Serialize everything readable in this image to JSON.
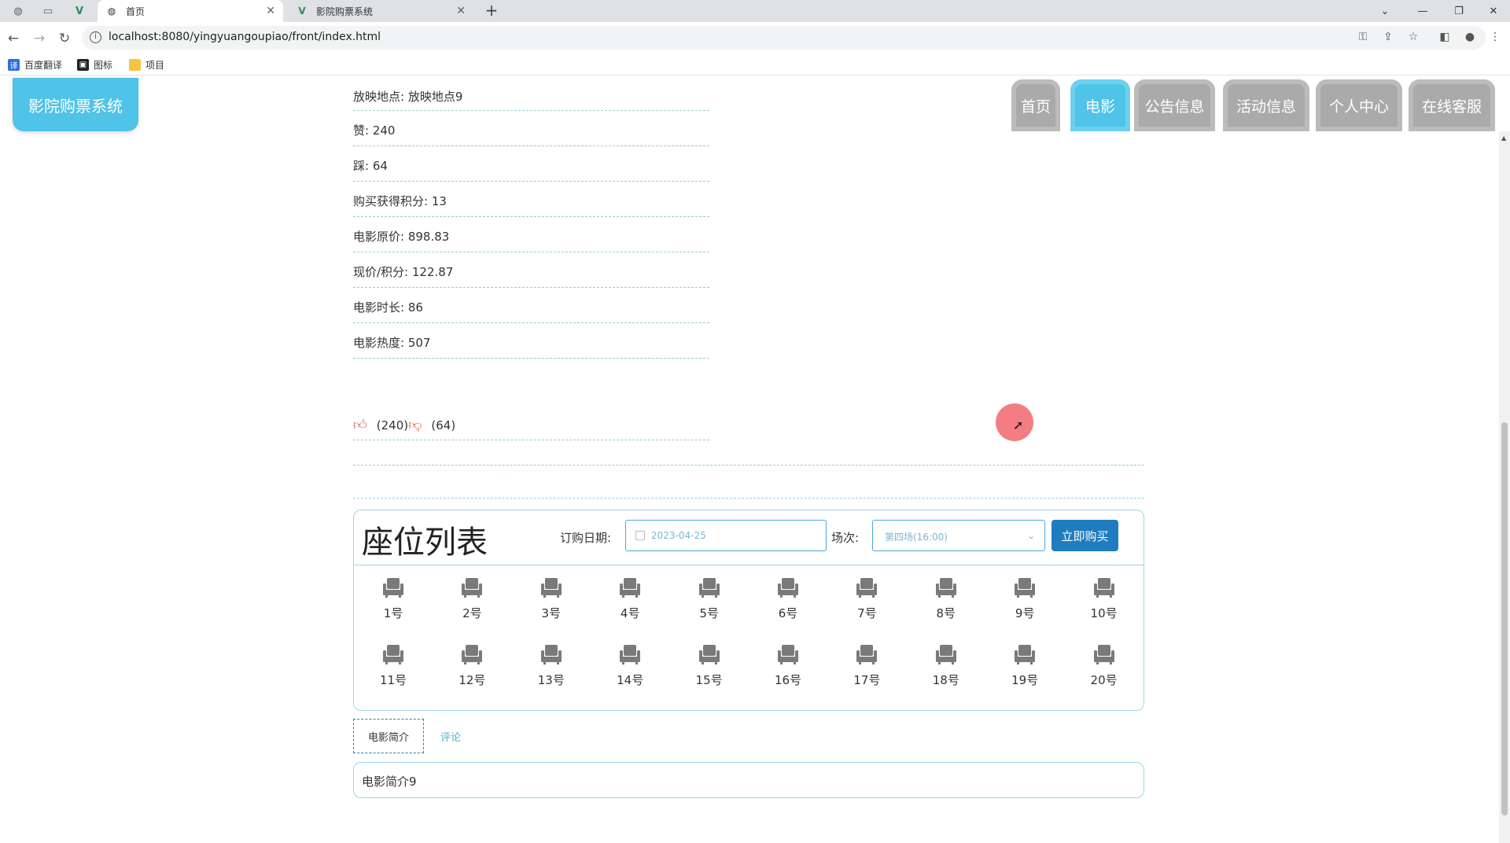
{
  "browser": {
    "tabs": [
      {
        "title": "首页",
        "active": true
      },
      {
        "title": "影院购票系统",
        "active": false
      }
    ],
    "url": "localhost:8080/yingyuangoupiao/front/index.html",
    "bookmarks": [
      "百度翻译",
      "图标",
      "项目"
    ]
  },
  "site": {
    "logo": "影院购票系统",
    "nav": [
      "首页",
      "电影",
      "公告信息",
      "活动信息",
      "个人中心",
      "在线客服"
    ],
    "active_nav": "电影"
  },
  "details": [
    "放映地点: 放映地点9",
    "赞: 240",
    "踩: 64",
    "购买获得积分: 13",
    "电影原价: 898.83",
    "现价/积分: 122.87",
    "电影时长: 86",
    "电影热度: 507"
  ],
  "votes": {
    "up": "(240)",
    "down": "(64)"
  },
  "seats": {
    "title": "座位列表",
    "date_label": "订购日期:",
    "date_value": "2023-04-25",
    "show_label": "场次:",
    "show_value": "第四场(16:00)",
    "buy_label": "立即购买",
    "list": [
      "1号",
      "2号",
      "3号",
      "4号",
      "5号",
      "6号",
      "7号",
      "8号",
      "9号",
      "10号",
      "11号",
      "12号",
      "13号",
      "14号",
      "15号",
      "16号",
      "17号",
      "18号",
      "19号",
      "20号"
    ]
  },
  "tabs": {
    "intro": "电影简介",
    "comment": "评论"
  },
  "intro_text": "电影简介9",
  "colors": {
    "accent": "#4fc3e8",
    "nav_inactive": "#aaaaaa",
    "buy_button": "#1f7cbf"
  }
}
